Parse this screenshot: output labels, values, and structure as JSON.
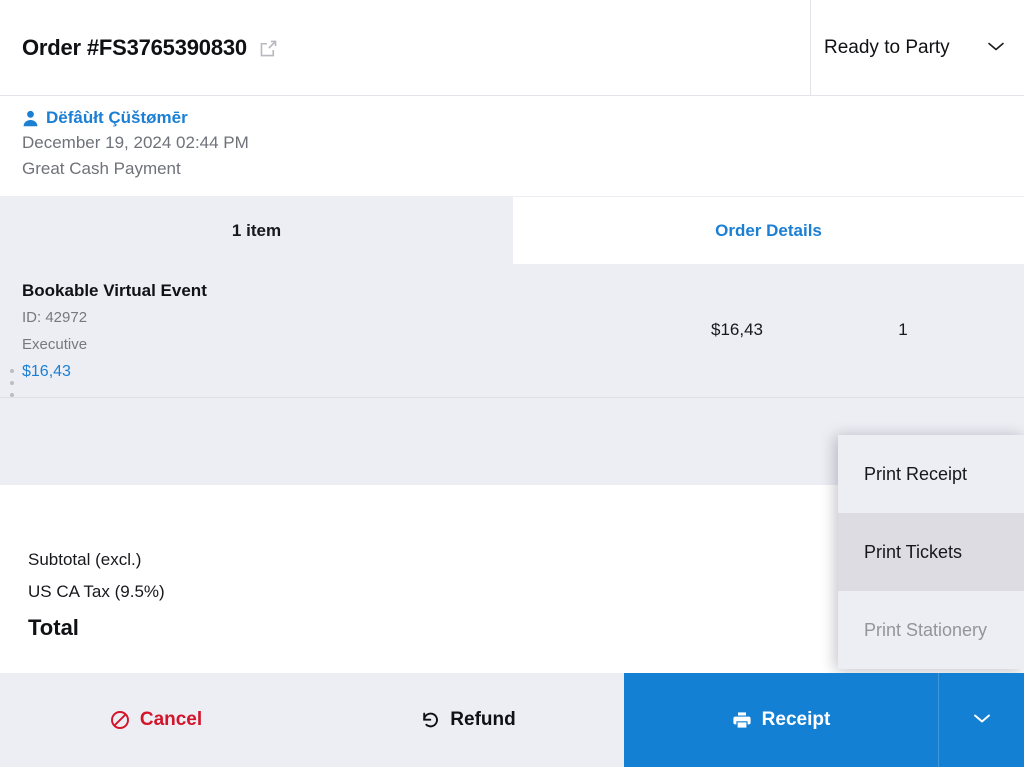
{
  "header": {
    "order_title": "Order #FS3765390830",
    "external_link_icon": "external-link-icon",
    "status": {
      "value": "Ready to Party",
      "chevron_icon": "chevron-down-icon"
    }
  },
  "customer": {
    "person_icon": "person-icon",
    "name": "Dëfâùłt Çüštømēr",
    "date": "December 19, 2024 02:44 PM",
    "payment_method": "Great Cash Payment"
  },
  "tabs": [
    {
      "label": "1 item",
      "active": false
    },
    {
      "label": "Order Details",
      "active": true
    }
  ],
  "items": [
    {
      "name": "Bookable Virtual Event",
      "id_label": "ID: 42972",
      "variant": "Executive",
      "price_link": "$16,43",
      "price": "$16,43",
      "quantity": "1",
      "drag_handle_icon": "drag-handle-icon"
    }
  ],
  "totals": [
    {
      "label": "Subtotal (excl.)",
      "value": ""
    },
    {
      "label": "US CA Tax (9.5%)",
      "value": ""
    }
  ],
  "grand_total": {
    "label": "Total",
    "value": ""
  },
  "print_menu": [
    {
      "label": "Print Receipt",
      "state": "normal"
    },
    {
      "label": "Print Tickets",
      "state": "highlighted"
    },
    {
      "label": "Print Stationery",
      "state": "disabled"
    }
  ],
  "actions": {
    "cancel": {
      "label": "Cancel",
      "icon": "no-entry-icon"
    },
    "refund": {
      "label": "Refund",
      "icon": "undo-arrow-icon"
    },
    "receipt": {
      "label": "Receipt",
      "icon": "printer-icon"
    },
    "receipt_caret": {
      "icon": "chevron-down-icon"
    }
  },
  "colors": {
    "accent_blue": "#1380d4",
    "link_blue": "#1b7fd4",
    "danger_red": "#d3142a",
    "surface_gray": "#eceef4",
    "menu_highlight": "#dcdce2",
    "text_primary": "#101114",
    "text_muted": "#6f7278"
  }
}
